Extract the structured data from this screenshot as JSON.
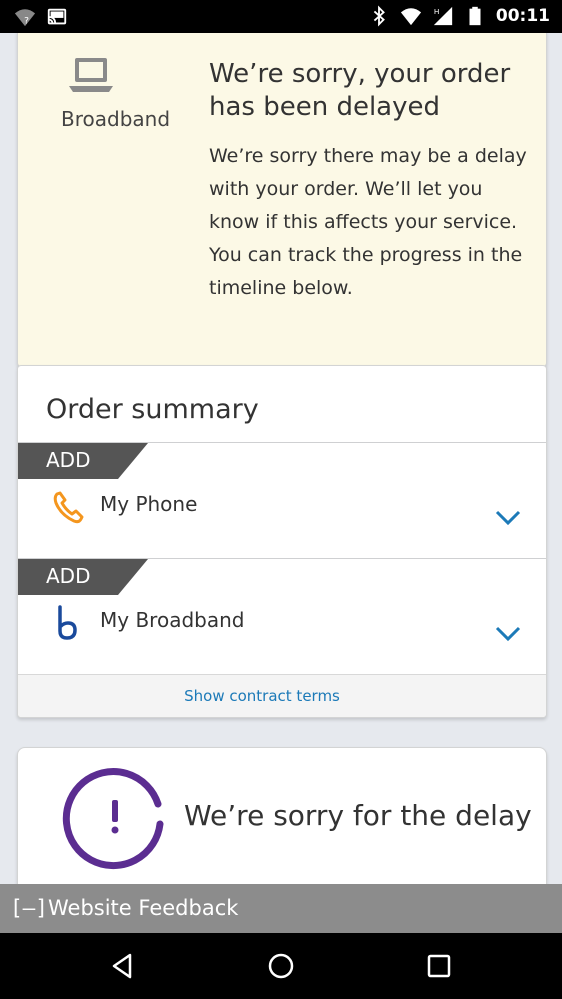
{
  "status_bar": {
    "time": "00:11",
    "left_icons": [
      "wifi-question-icon",
      "cast-icon"
    ],
    "right_icons": [
      "bluetooth-icon",
      "wifi-icon",
      "signal-icon",
      "battery-icon"
    ]
  },
  "alert": {
    "product_icon": "laptop-icon",
    "product_label": "Broadband",
    "title": "We’re sorry, your order has been delayed",
    "body": "We’re sorry there may be a delay with your order. We’ll let you know if this affects your service. You can track the progress in the timeline below.",
    "background": "#fcf9e6"
  },
  "order_summary": {
    "title": "Order summary",
    "items": [
      {
        "tag": "ADD",
        "icon": "phone-icon",
        "label": "My Phone"
      },
      {
        "tag": "ADD",
        "icon": "broadband-b-icon",
        "label": "My Broadband"
      }
    ],
    "contract_link": "Show contract terms"
  },
  "delay": {
    "icon": "exclamation-ring-icon",
    "title": "We’re sorry for the delay",
    "accent": "#5b2d91"
  },
  "feedback": {
    "icon": "[–]",
    "label": "Website Feedback"
  },
  "nav": {
    "buttons": [
      "back-icon",
      "home-icon",
      "recents-icon"
    ]
  },
  "colors": {
    "link": "#1c7ab8",
    "tag": "#555555",
    "phone_icon": "#f4961e",
    "broadband_icon": "#1a4a9c",
    "chevron": "#1c7ab8"
  }
}
